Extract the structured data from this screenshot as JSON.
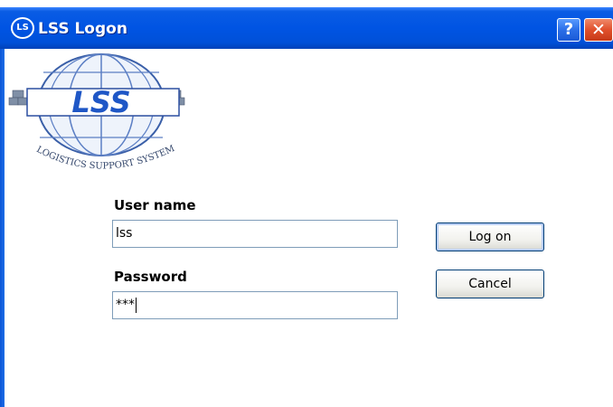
{
  "window": {
    "title": "LSS Logon",
    "icon": "lss-app-icon",
    "icon_glyph": "LS",
    "help_glyph": "?",
    "close_glyph": "✕"
  },
  "logo": {
    "text": "LSS",
    "tagline": "LOGISTICS SUPPORT SYSTEM"
  },
  "form": {
    "username_label": "User name",
    "username_value": "lss",
    "password_label": "Password",
    "password_value": "***"
  },
  "buttons": {
    "logon_label": "Log on",
    "cancel_label": "Cancel"
  },
  "colors": {
    "titlebar": "#0054e3",
    "close_button": "#e0502c",
    "logo_blue": "#1f57c6"
  }
}
